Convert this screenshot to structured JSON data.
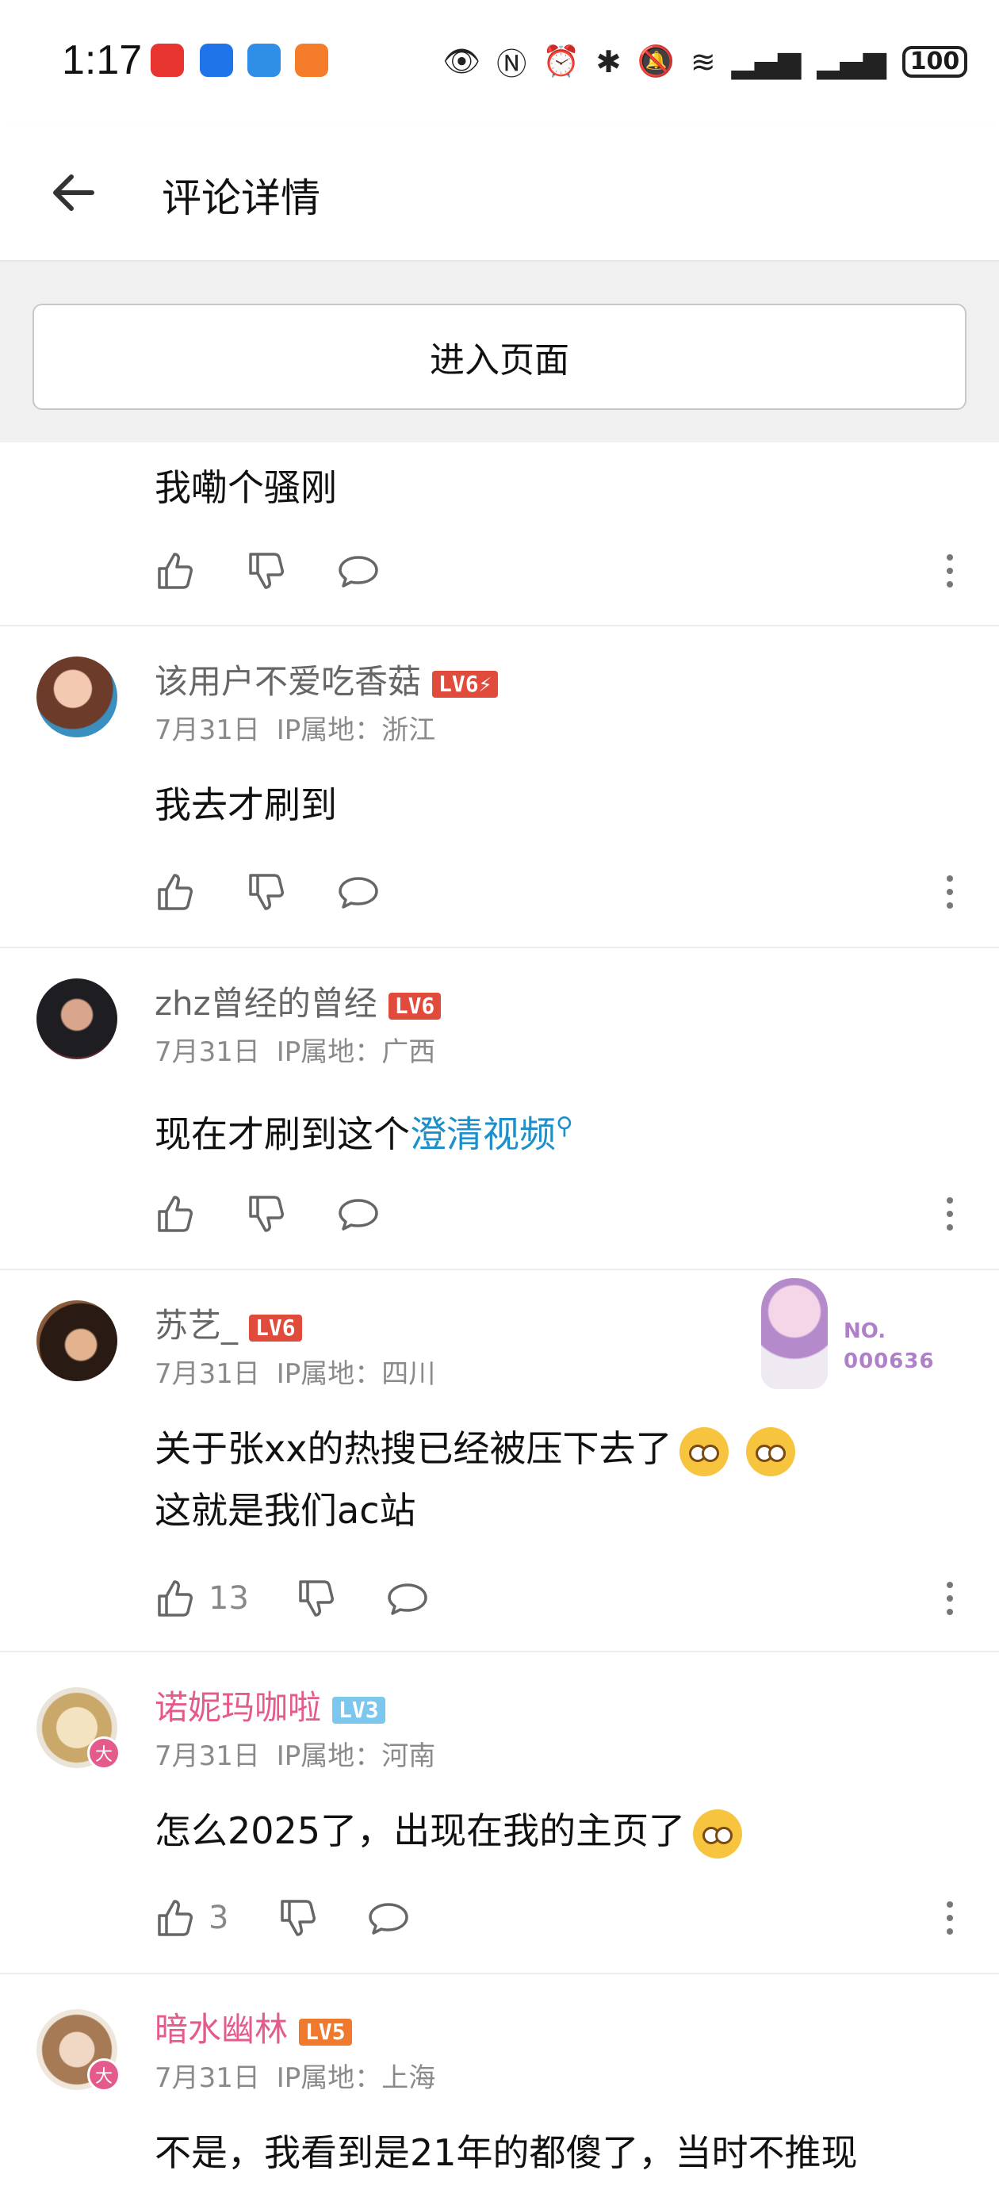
{
  "status": {
    "time": "1:17",
    "battery": "100"
  },
  "header": {
    "title": "评论详情"
  },
  "enter_button": "进入页面",
  "partial_comment": {
    "text": "我嘞个骚刚"
  },
  "comments": [
    {
      "name": "该用户不爱吃香菇",
      "level": "LV6⚡",
      "date": "7月31日",
      "ip": "IP属地：浙江",
      "text": "我去才刷到",
      "likes": ""
    },
    {
      "name": "zhz曾经的曾经",
      "level": "LV6",
      "date": "7月31日",
      "ip": "IP属地：广西",
      "text_prefix": "现在才刷到这个",
      "link": "澄清视频",
      "likes": ""
    },
    {
      "name": "苏艺_",
      "level": "LV6",
      "date": "7月31日",
      "ip": "IP属地：四川",
      "text_line1": "关于张xx的热搜已经被压下去了",
      "text_line2": "这就是我们ac站",
      "likes": "13",
      "sticker_no": "NO.",
      "sticker_num": "000636"
    },
    {
      "name": "诺妮玛咖啦",
      "level": "LV3",
      "date": "7月31日",
      "ip": "IP属地：河南",
      "text": "怎么2025了，出现在我的主页了",
      "likes": "3",
      "badge": "大"
    },
    {
      "name": "暗水幽林",
      "level": "LV5",
      "date": "7月31日",
      "ip": "IP属地：上海",
      "text": "不是，我看到是21年的都傻了，当时不推现",
      "badge": "大"
    }
  ],
  "colors": {
    "accent_link": "#1e8fc8",
    "vip_name": "#e55a8c",
    "lv6": "#e04b3c",
    "lv5": "#ef7a2d",
    "lv3": "#7cc7ee"
  }
}
